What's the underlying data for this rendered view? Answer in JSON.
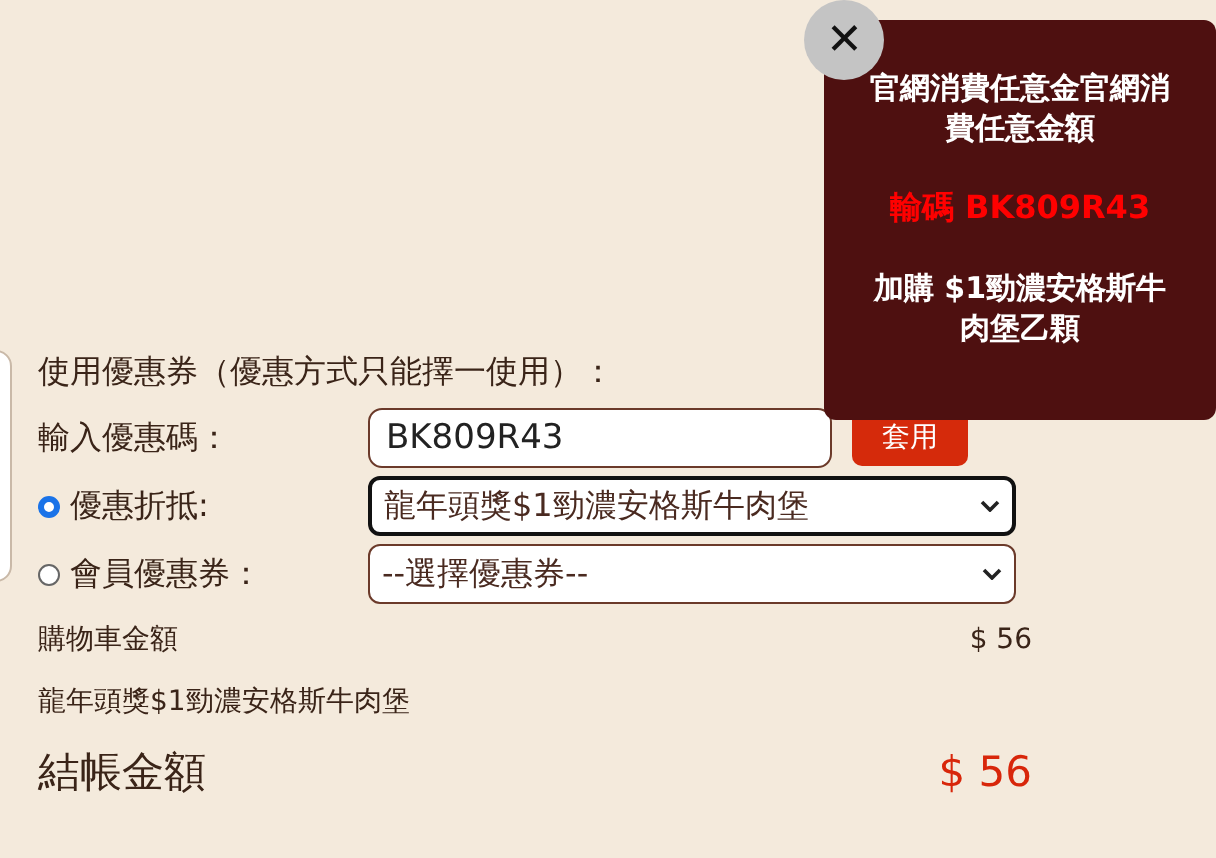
{
  "popup": {
    "close": "✕",
    "message": "官網消費任意金官網消費任意金額",
    "code_line": "輸碼 BK809R43",
    "offer": "加購 $1勁濃安格斯牛肉堡乙顆"
  },
  "coupon": {
    "heading": "使用優惠券（優惠方式只能擇一使用）：",
    "code_label": "輸入優惠碼：",
    "code_value": "BK809R43",
    "apply_button": "套用",
    "options": [
      {
        "label": "優惠折抵:",
        "selected": true,
        "value": "龍年頭獎$1勁濃安格斯牛肉堡"
      },
      {
        "label": "會員優惠券：",
        "selected": false,
        "value": "--選擇優惠券--"
      }
    ]
  },
  "summary": [
    {
      "label": "購物車金額",
      "amount": "$ 56"
    },
    {
      "label": "龍年頭獎$1勁濃安格斯牛肉堡"
    }
  ],
  "total": {
    "label": "結帳金額",
    "amount": "$ 56"
  }
}
